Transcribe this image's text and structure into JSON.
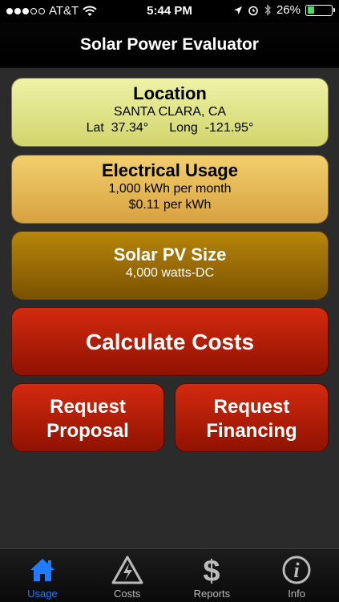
{
  "status": {
    "carrier": "AT&T",
    "time": "5:44 PM",
    "battery": "26%",
    "battery_level": 0.26
  },
  "nav": {
    "title": "Solar Power Evaluator"
  },
  "location": {
    "title": "Location",
    "place": "SANTA CLARA, CA",
    "lat": "Lat  37.34°",
    "long": "Long  -121.95°"
  },
  "usage": {
    "title": "Electrical Usage",
    "kwh": "1,000 kWh per month",
    "rate": "$0.11 per kWh"
  },
  "pv": {
    "title": "Solar PV Size",
    "size": "4,000 watts-DC"
  },
  "buttons": {
    "calculate": "Calculate Costs",
    "proposal_1": "Request",
    "proposal_2": "Proposal",
    "financing_1": "Request",
    "financing_2": "Financing"
  },
  "tabs": [
    {
      "label": "Usage",
      "icon": "house-icon",
      "active": true
    },
    {
      "label": "Costs",
      "icon": "high-voltage-icon",
      "active": false
    },
    {
      "label": "Reports",
      "icon": "dollar-icon",
      "active": false
    },
    {
      "label": "Info",
      "icon": "info-icon",
      "active": false
    }
  ],
  "colors": {
    "accent": "#1e7cff",
    "location_card": "#e2e48a",
    "usage_card": "#e6b754",
    "pv_card": "#996b05",
    "action_red": "#b61e08"
  }
}
